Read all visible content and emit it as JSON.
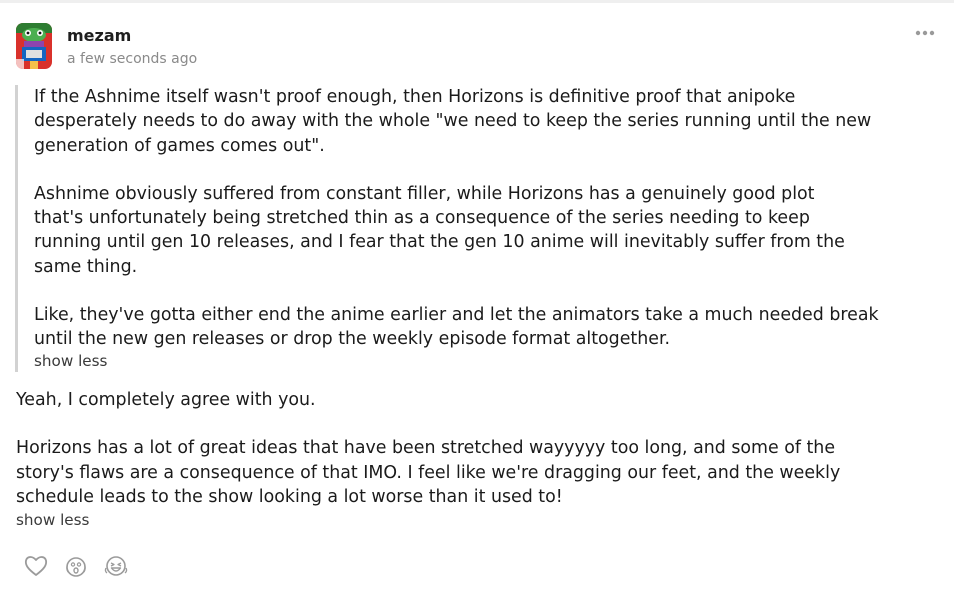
{
  "post": {
    "username": "mezam",
    "timestamp": "a few seconds ago",
    "more_label": "•••"
  },
  "quote": {
    "para1": [
      "If the Ashnime itself wasn't proof enough, then Horizons is definitive proof that anipoke",
      "desperately needs to do away with the whole \"we need to keep the series running until the new",
      "generation of games comes out\"."
    ],
    "para2": [
      "Ashnime obviously suffered from constant filler, while Horizons has a genuinely good plot",
      "that's unfortunately being stretched thin as a consequence of the series needing to keep",
      "running until gen 10 releases, and I fear that the gen 10 anime will inevitably suffer from the",
      "same thing."
    ],
    "para3": [
      "Like, they've gotta either end the anime earlier and let the animators take a much needed break",
      "until the new gen releases or drop the weekly episode format altogether."
    ],
    "show_less": "show less"
  },
  "reply": {
    "para1": [
      "Yeah, I completely agree with you."
    ],
    "para2": [
      "Horizons has a lot of great ideas that have been stretched wayyyyy too long, and some of the",
      "story's flaws are a consequence of that IMO. I feel like we're dragging our feet, and the weekly",
      "schedule leads to the show looking a lot worse than it used to!"
    ],
    "show_less": "show less"
  },
  "reactions": [
    "heart-icon",
    "surprised-face-icon",
    "laughing-face-icon"
  ]
}
